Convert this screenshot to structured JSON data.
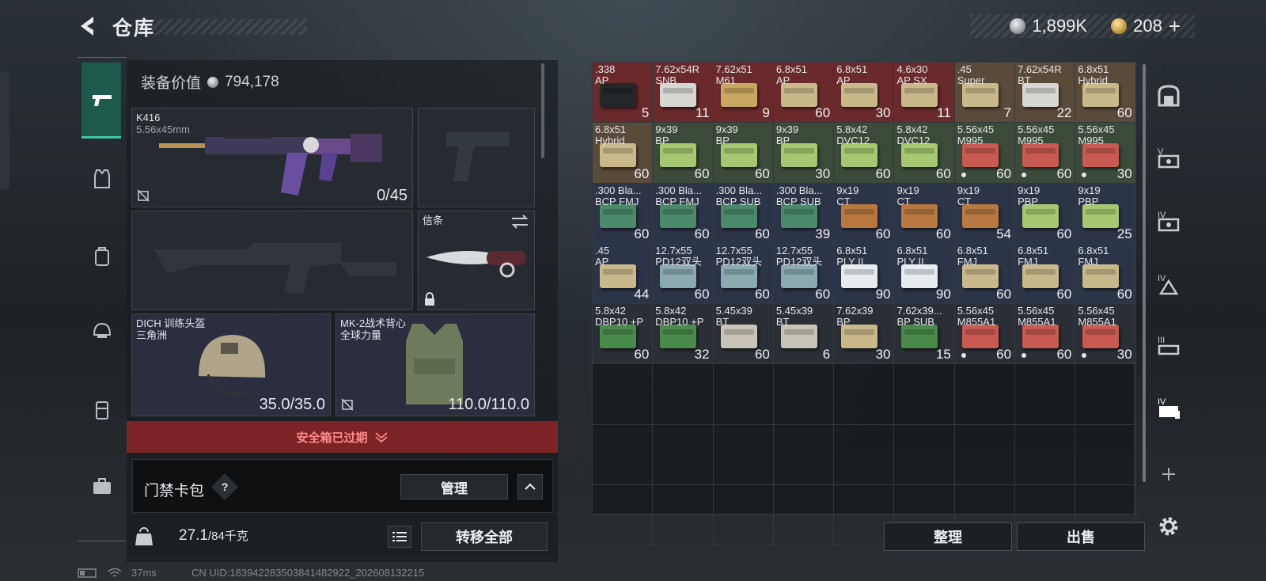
{
  "header": {
    "title": "仓库",
    "silver_amount": "1,899K",
    "gold_amount": "208",
    "gold_add": "+"
  },
  "loadout": {
    "equipment_value_label": "装备价值",
    "equipment_value": "794,178",
    "primary_weapon": {
      "name": "K416",
      "caliber": "5.56x45mm",
      "ammo": "0/45"
    },
    "melee": {
      "label": "信条"
    },
    "helmet": {
      "name": "DICH 训练头盔",
      "brand": "三角洲",
      "durability": "35.0/35.0"
    },
    "armor": {
      "name": "MK-2战术背心",
      "brand": "全球力量",
      "durability": "110.0/110.0"
    },
    "secure_case_status": "安全箱已过期",
    "keycard": {
      "label": "门禁卡包",
      "help": "?",
      "manage_button": "管理"
    },
    "weight": {
      "current": "27.1",
      "max": "/84千克",
      "transfer_all_button": "转移全部"
    }
  },
  "stash": {
    "items": [
      {
        "n": ".338",
        "s": "AP",
        "q": "5",
        "c": "#23272a",
        "bg": "#6a2a2c"
      },
      {
        "n": "7.62x54R",
        "s": "SNB",
        "q": "11",
        "c": "#d6d6d2",
        "bg": "#6a2a2c"
      },
      {
        "n": "7.62x51",
        "s": "M61",
        "q": "9",
        "c": "#c8a860",
        "bg": "#6a2a2c"
      },
      {
        "n": "6.8x51",
        "s": "AP",
        "q": "60",
        "c": "#c9b98a",
        "bg": "#6a2a2c"
      },
      {
        "n": "6.8x51",
        "s": "AP",
        "q": "30",
        "c": "#c9b98a",
        "bg": "#6a2a2c"
      },
      {
        "n": "4.6x30",
        "s": "AP SX",
        "q": "11",
        "c": "#c9b98a",
        "bg": "#6a2a2c"
      },
      {
        "n": ".45",
        "s": "Super",
        "q": "7",
        "c": "#c9b98a",
        "bg": "#5a4a3a"
      },
      {
        "n": "7.62x54R",
        "s": "BT",
        "q": "22",
        "c": "#d6d6d2",
        "bg": "#5a4a3a"
      },
      {
        "n": "6.8x51",
        "s": "Hybrid",
        "q": "60",
        "c": "#c9b98a",
        "bg": "#5a4a3a"
      },
      {
        "n": "6.8x51",
        "s": "Hybrid",
        "q": "60",
        "c": "#c9b98a",
        "bg": "#5a4a3a"
      },
      {
        "n": "9x39",
        "s": "BP",
        "q": "60",
        "c": "#a6c870",
        "bg": "#3c4a3a"
      },
      {
        "n": "9x39",
        "s": "BP",
        "q": "60",
        "c": "#a6c870",
        "bg": "#3c4a3a"
      },
      {
        "n": "9x39",
        "s": "BP",
        "q": "30",
        "c": "#a6c870",
        "bg": "#3c4a3a"
      },
      {
        "n": "5.8x42",
        "s": "DVC12",
        "q": "60",
        "c": "#a6c870",
        "bg": "#3c4a3a"
      },
      {
        "n": "5.8x42",
        "s": "DVC12",
        "q": "60",
        "c": "#a6c870",
        "bg": "#3c4a3a"
      },
      {
        "n": "5.56x45",
        "s": "M995",
        "q": "60",
        "c": "#c85a50",
        "bg": "#3c4a3a",
        "dot": true
      },
      {
        "n": "5.56x45",
        "s": "M995",
        "q": "60",
        "c": "#c85a50",
        "bg": "#3c4a3a",
        "dot": true
      },
      {
        "n": "5.56x45",
        "s": "M995",
        "q": "30",
        "c": "#c85a50",
        "bg": "#3c4a3a",
        "dot": true
      },
      {
        "n": ".300 Bla...",
        "s": "BCP FMJ",
        "q": "60",
        "c": "#4a8a6a",
        "bg": "#2c3448"
      },
      {
        "n": ".300 Bla...",
        "s": "BCP FMJ",
        "q": "60",
        "c": "#4a8a6a",
        "bg": "#2c3448"
      },
      {
        "n": ".300 Bla...",
        "s": "BCP SUB",
        "q": "60",
        "c": "#4a8a6a",
        "bg": "#2c3448"
      },
      {
        "n": ".300 Bla...",
        "s": "BCP SUB",
        "q": "39",
        "c": "#4a8a6a",
        "bg": "#2c3448"
      },
      {
        "n": "9x19",
        "s": "CT",
        "q": "60",
        "c": "#b87840",
        "bg": "#2c3448"
      },
      {
        "n": "9x19",
        "s": "CT",
        "q": "60",
        "c": "#b87840",
        "bg": "#2c3448"
      },
      {
        "n": "9x19",
        "s": "CT",
        "q": "54",
        "c": "#b87840",
        "bg": "#2c3448"
      },
      {
        "n": "9x19",
        "s": "PBP",
        "q": "60",
        "c": "#a6c870",
        "bg": "#2c3448"
      },
      {
        "n": "9x19",
        "s": "PBP",
        "q": "25",
        "c": "#a6c870",
        "bg": "#2c3448"
      },
      {
        "n": ".45",
        "s": "AP",
        "q": "44",
        "c": "#c9b98a",
        "bg": "#2c3448"
      },
      {
        "n": "12.7x55",
        "s": "PD12双头",
        "q": "60",
        "c": "#8aaab0",
        "bg": "#2c3448"
      },
      {
        "n": "12.7x55",
        "s": "PD12双头",
        "q": "60",
        "c": "#8aaab0",
        "bg": "#2c3448"
      },
      {
        "n": "12.7x55",
        "s": "PD12双头",
        "q": "60",
        "c": "#8aaab0",
        "bg": "#2c3448"
      },
      {
        "n": "6.8x51",
        "s": "PLY II",
        "q": "90",
        "c": "#e8ecee",
        "bg": "#2c3448"
      },
      {
        "n": "6.8x51",
        "s": "PLY II",
        "q": "90",
        "c": "#e8ecee",
        "bg": "#2c3448"
      },
      {
        "n": "6.8x51",
        "s": "FMJ",
        "q": "60",
        "c": "#c9b98a",
        "bg": "#2c3448"
      },
      {
        "n": "6.8x51",
        "s": "FMJ",
        "q": "60",
        "c": "#c9b98a",
        "bg": "#2c3448"
      },
      {
        "n": "6.8x51",
        "s": "FMJ",
        "q": "60",
        "c": "#c9b98a",
        "bg": "#2c3448"
      },
      {
        "n": "5.8x42",
        "s": "DBP10 +P",
        "q": "60",
        "c": "#4a8a4a",
        "bg": "#2a2f36"
      },
      {
        "n": "5.8x42",
        "s": "DBP10 +P",
        "q": "32",
        "c": "#4a8a4a",
        "bg": "#2a2f36"
      },
      {
        "n": "5.45x39",
        "s": "BT",
        "q": "60",
        "c": "#c9c4b8",
        "bg": "#2a2f36"
      },
      {
        "n": "5.45x39",
        "s": "BT",
        "q": "6",
        "c": "#c9c4b8",
        "bg": "#2a2f36"
      },
      {
        "n": "7.62x39",
        "s": "BP",
        "q": "30",
        "c": "#c9b98a",
        "bg": "#2a2f36"
      },
      {
        "n": "7.62x39...",
        "s": "BP SUB",
        "q": "15",
        "c": "#4a8a4a",
        "bg": "#2a2f36"
      },
      {
        "n": "5.56x45",
        "s": "M855A1",
        "q": "60",
        "c": "#c85a50",
        "bg": "#2a2f36",
        "dot": true
      },
      {
        "n": "5.56x45",
        "s": "M855A1",
        "q": "60",
        "c": "#c85a50",
        "bg": "#2a2f36",
        "dot": true
      },
      {
        "n": "5.56x45",
        "s": "M855A1",
        "q": "30",
        "c": "#c85a50",
        "bg": "#2a2f36",
        "dot": true
      }
    ],
    "empty_cells": 27,
    "sort_button": "整理",
    "sell_button": "出售"
  },
  "right_tabs": [
    "",
    "V",
    "IV",
    "IV",
    "III",
    "IV"
  ],
  "status": {
    "ping": "37ms",
    "uid": "CN UID:183942283503841482922_202608132215"
  }
}
